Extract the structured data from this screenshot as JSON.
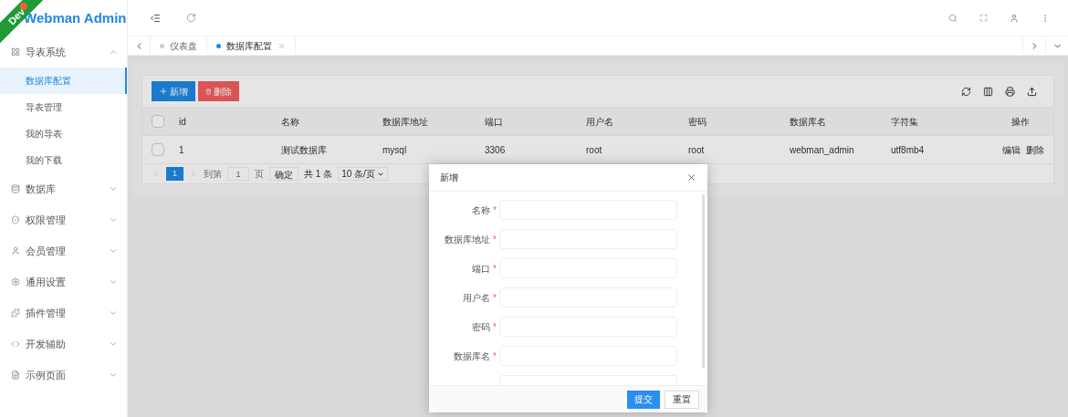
{
  "env_ribbon": {
    "label": "Dev"
  },
  "logo": {
    "title": "Webman Admin"
  },
  "sidebar": {
    "items": [
      {
        "label": "导表系统",
        "kind": "grid",
        "expanded": true,
        "children": [
          {
            "label": "数据库配置",
            "selected": true
          },
          {
            "label": "导表管理",
            "selected": false
          },
          {
            "label": "我的导表",
            "selected": false
          },
          {
            "label": "我的下载",
            "selected": false
          }
        ]
      },
      {
        "label": "数据库",
        "kind": "database",
        "expanded": false
      },
      {
        "label": "权限管理",
        "kind": "shield",
        "expanded": false
      },
      {
        "label": "会员管理",
        "kind": "user",
        "expanded": false
      },
      {
        "label": "通用设置",
        "kind": "gear",
        "expanded": false
      },
      {
        "label": "插件管理",
        "kind": "plugin",
        "expanded": false
      },
      {
        "label": "开发辅助",
        "kind": "code",
        "expanded": false
      },
      {
        "label": "示例页面",
        "kind": "pages",
        "expanded": false
      }
    ]
  },
  "tabs": [
    {
      "label": "仪表盘",
      "selected": false,
      "closable": false
    },
    {
      "label": "数据库配置",
      "selected": true,
      "closable": true
    }
  ],
  "toolbar": {
    "buttons": [
      {
        "label": "新增",
        "kind": "add"
      },
      {
        "label": "删除",
        "kind": "delete"
      }
    ]
  },
  "table": {
    "columns": [
      "id",
      "名称",
      "数据库地址",
      "端口",
      "用户名",
      "密码",
      "数据库名",
      "字符集",
      "操作"
    ],
    "rows": [
      {
        "checked": false,
        "cells": [
          "1",
          "测试数据库",
          "mysql",
          "3306",
          "root",
          "root",
          "webman_admin",
          "utf8mb4"
        ],
        "actions": [
          "编辑",
          "删除"
        ]
      }
    ],
    "header_checked": false
  },
  "pagination": {
    "pages": [
      {
        "label": "1",
        "selected": true
      }
    ],
    "goto_label": "到第",
    "goto_value": "1",
    "page_unit": "页",
    "confirm": "确定",
    "total": "共 1 条",
    "page_size": "10 条/页"
  },
  "dialog": {
    "title": "新增",
    "fields": [
      {
        "label": "名称",
        "required_mark": "*"
      },
      {
        "label": "数据库地址",
        "required_mark": "*"
      },
      {
        "label": "端口",
        "required_mark": "*"
      },
      {
        "label": "用户名",
        "required_mark": "*"
      },
      {
        "label": "密码",
        "required_mark": "*"
      },
      {
        "label": "数据库名",
        "required_mark": "*"
      }
    ],
    "buttons": [
      {
        "label": "提交",
        "kind": "primary"
      },
      {
        "label": "重置",
        "kind": "default"
      }
    ]
  }
}
